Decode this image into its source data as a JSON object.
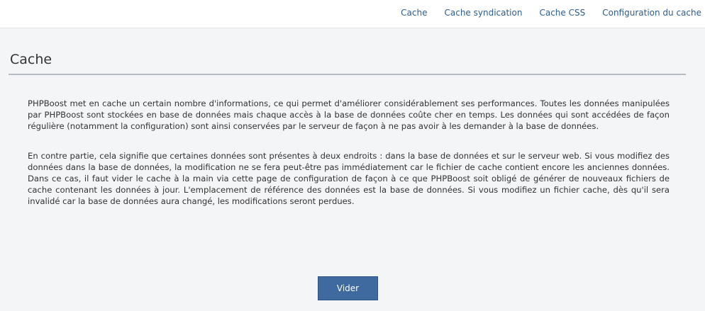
{
  "nav": {
    "links": [
      {
        "label": "Cache"
      },
      {
        "label": "Cache syndication"
      },
      {
        "label": "Cache CSS"
      },
      {
        "label": "Configuration du cache"
      }
    ]
  },
  "page": {
    "title": "Cache",
    "paragraphs": [
      "PHPBoost met en cache un certain nombre d'informations, ce qui permet d'améliorer considérablement ses performances. Toutes les données manipulées par PHPBoost sont stockées en base de données mais chaque accès à la base de données coûte cher en temps. Les données qui sont accédées de façon régulière (notamment la configuration) sont ainsi conservées par le serveur de façon à ne pas avoir à les demander à la base de données.",
      "En contre partie, cela signifie que certaines données sont présentes à deux endroits : dans la base de données et sur le serveur web. Si vous modifiez des données dans la base de données, la modification ne se fera peut-être pas immédiatement car le fichier de cache contient encore les anciennes données. Dans ce cas, il faut vider le cache à la main via cette page de configuration de façon à ce que PHPBoost soit obligé de générer de nouveaux fichiers de cache contenant les données à jour. L'emplacement de référence des données est la base de données. Si vous modifiez un fichier cache, dès qu'il sera invalidé car la base de données aura changé, les modifications seront perdues."
    ],
    "button_label": "Vider"
  },
  "colors": {
    "link": "#2c5d8f",
    "button": "#3e6aa0",
    "background": "#f4f5f7"
  }
}
